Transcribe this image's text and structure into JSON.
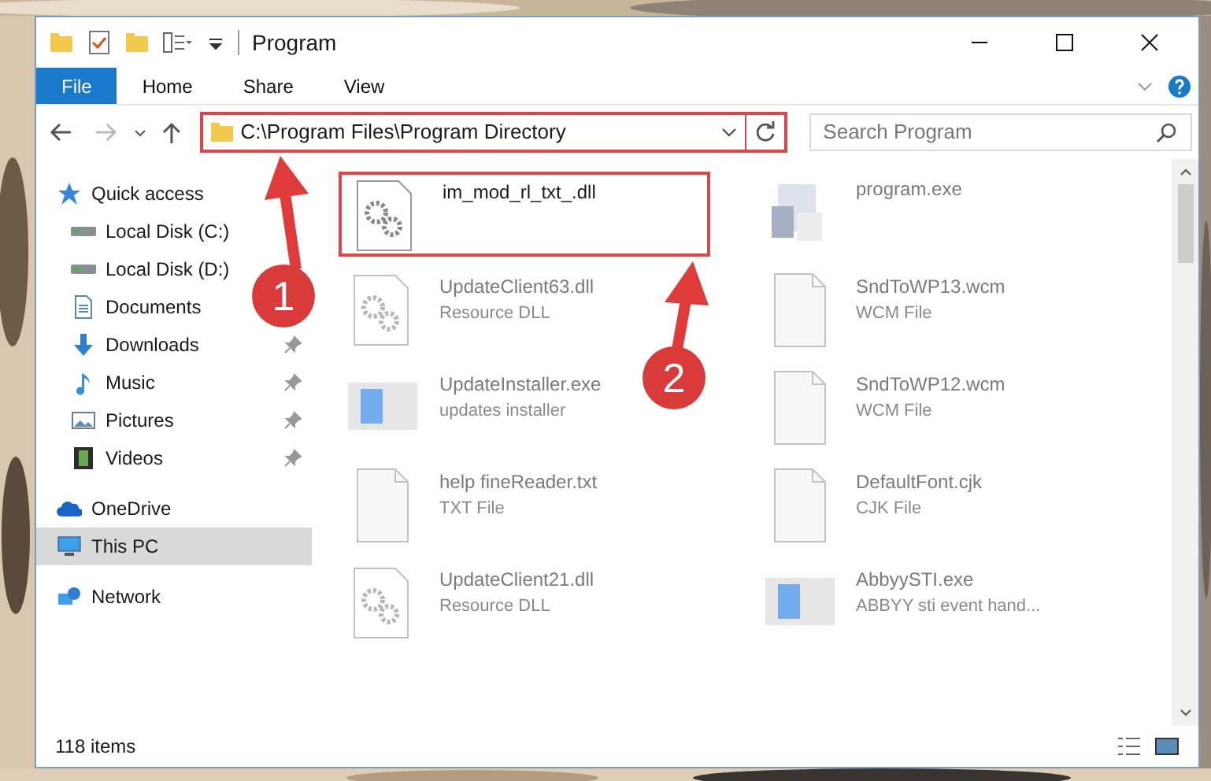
{
  "window": {
    "title": "Program"
  },
  "ribbon_tabs": [
    {
      "label": "File",
      "selected": true
    },
    {
      "label": "Home",
      "selected": false
    },
    {
      "label": "Share",
      "selected": false
    },
    {
      "label": "View",
      "selected": false
    }
  ],
  "address": {
    "path": "C:\\Program Files\\Program Directory"
  },
  "search": {
    "placeholder": "Search Program"
  },
  "sidebar": {
    "items": [
      {
        "label": "Quick access",
        "kind": "star",
        "pinned": false,
        "selected": false,
        "indent": false
      },
      {
        "label": "Local Disk (C:)",
        "kind": "disk",
        "pinned": false,
        "selected": false,
        "indent": true
      },
      {
        "label": "Local Disk (D:)",
        "kind": "disk",
        "pinned": false,
        "selected": false,
        "indent": true
      },
      {
        "label": "Documents",
        "kind": "documents",
        "pinned": false,
        "selected": false,
        "indent": true
      },
      {
        "label": "Downloads",
        "kind": "downloads",
        "pinned": true,
        "selected": false,
        "indent": true
      },
      {
        "label": "Music",
        "kind": "music",
        "pinned": true,
        "selected": false,
        "indent": true
      },
      {
        "label": "Pictures",
        "kind": "pictures",
        "pinned": true,
        "selected": false,
        "indent": true
      },
      {
        "label": "Videos",
        "kind": "videos",
        "pinned": true,
        "selected": false,
        "indent": true
      },
      {
        "label": "OneDrive",
        "kind": "cloud",
        "pinned": false,
        "selected": false,
        "indent": false
      },
      {
        "label": "This PC",
        "kind": "pc",
        "pinned": false,
        "selected": true,
        "indent": false
      },
      {
        "label": "Network",
        "kind": "network",
        "pinned": false,
        "selected": false,
        "indent": false
      }
    ]
  },
  "files": [
    {
      "name": "im_mod_rl_txt_.dll",
      "kind": "dll",
      "faded": false
    },
    {
      "name": "program.exe",
      "kind": "exe",
      "faded": true
    },
    {
      "name": "UpdateClient63.dll",
      "type": "Resource DLL",
      "kind": "dll",
      "faded": true
    },
    {
      "name": "SndToWP13.wcm",
      "type": "WCM File",
      "kind": "file",
      "faded": true
    },
    {
      "name": "UpdateInstaller.exe",
      "type": "updates installer",
      "kind": "app",
      "faded": true
    },
    {
      "name": "SndToWP12.wcm",
      "type": "WCM File",
      "kind": "file",
      "faded": true
    },
    {
      "name": "help fineReader.txt",
      "type": "TXT File",
      "kind": "file",
      "faded": true
    },
    {
      "name": "DefaultFont.cjk",
      "type": "CJK File",
      "kind": "file",
      "faded": true
    },
    {
      "name": "UpdateClient21.dll",
      "type": "Resource DLL",
      "kind": "dll",
      "faded": true
    },
    {
      "name": "AbbyySTI.exe",
      "type": "ABBYY sti event hand...",
      "kind": "app",
      "faded": true
    }
  ],
  "status_bar": {
    "item_count": "118 items"
  },
  "annotations": [
    {
      "number": "1"
    },
    {
      "number": "2"
    }
  ]
}
